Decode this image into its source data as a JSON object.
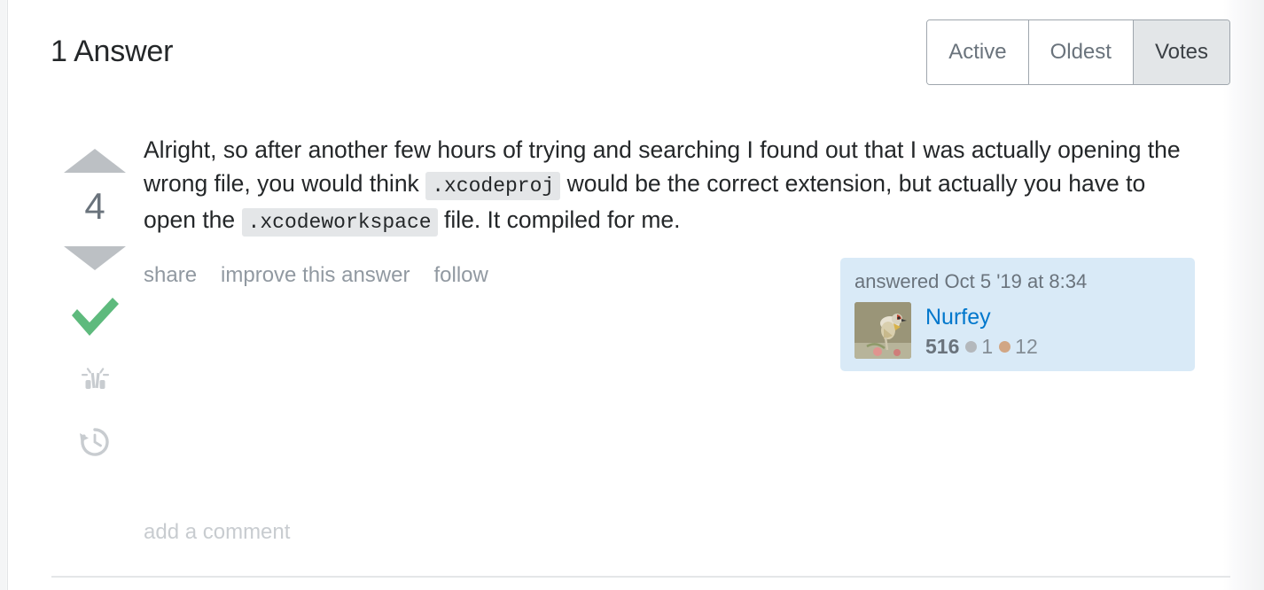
{
  "header": {
    "title": "1 Answer",
    "sort_tabs": [
      {
        "label": "Active",
        "selected": false
      },
      {
        "label": "Oldest",
        "selected": false
      },
      {
        "label": "Votes",
        "selected": true
      }
    ]
  },
  "answer": {
    "vote_count": "4",
    "upvote_icon": "triangle-up-icon",
    "downvote_icon": "triangle-down-icon",
    "accepted_icon": "checkmark-icon",
    "bookmark_icon": "bookmark-icon",
    "history_icon": "history-clock-icon",
    "body": {
      "part1": "Alright, so after another few hours of trying and searching I found out that I was actually opening the wrong file, you would think",
      "code1": ".xcodeproj",
      "part2": "would be the correct extension, but actually you have to open the",
      "code2": ".xcodeworkspace",
      "part3": "file. It compiled for me."
    },
    "actions": [
      {
        "label": "share"
      },
      {
        "label": "improve this answer"
      },
      {
        "label": "follow"
      }
    ],
    "signature": {
      "action_time": "answered Oct 5 '19 at 8:34",
      "user_name": "Nurfey",
      "reputation": "516",
      "silver_badge_count": "1",
      "bronze_badge_count": "12",
      "avatar_alt": "user-avatar-bird"
    },
    "comments": {
      "add_comment_label": "add a comment"
    }
  },
  "colors": {
    "accent_link": "#0077cc",
    "accepted_green": "#5eba7d",
    "vote_arrow_gray": "#bcc0c4",
    "card_blue": "#d9eaf7",
    "code_bg": "#e4e6e8",
    "silver_badge": "#b4b8bc",
    "bronze_badge": "#d1a684"
  }
}
